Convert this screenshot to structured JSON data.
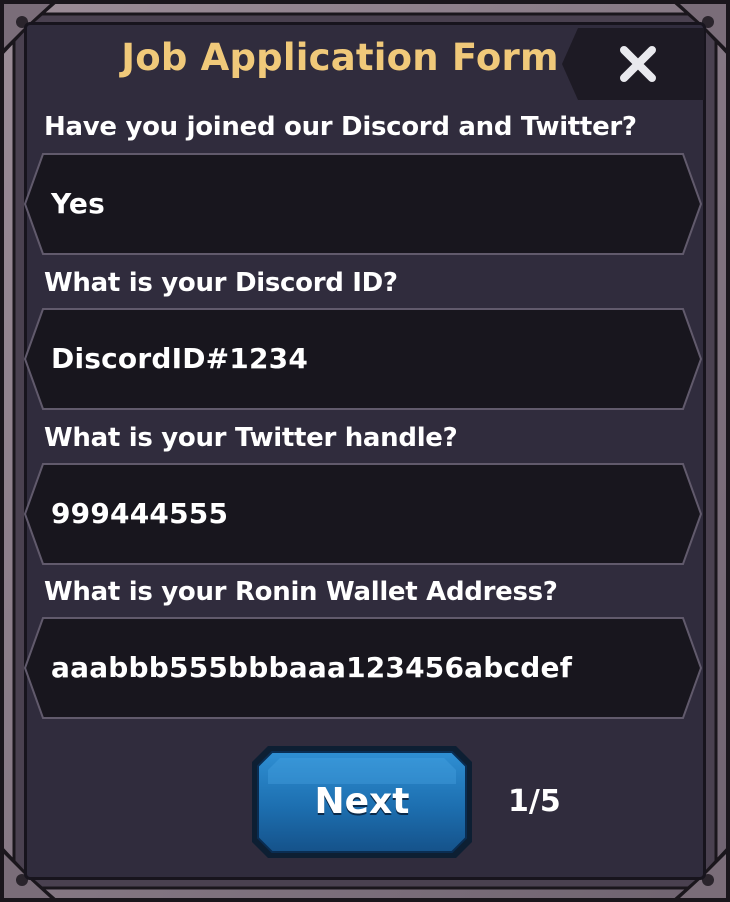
{
  "title": "Job Application Form",
  "close_icon": "close-x-icon",
  "questions": [
    {
      "label": "Have you joined our Discord and Twitter?",
      "answer": "Yes"
    },
    {
      "label": "What is your Discord ID?",
      "answer": "DiscordID#1234"
    },
    {
      "label": "What is your Twitter handle?",
      "answer": "999444555"
    },
    {
      "label": "What is your Ronin Wallet Address?",
      "answer": "aaabbb555bbbaaa123456abcdef"
    }
  ],
  "next_label": "Next",
  "page_indicator": "1/5",
  "colors": {
    "title": "#f0c97a",
    "panel": "#302c3d",
    "field": "#18161e",
    "frame": "#8a7b86",
    "button": "#1d6fb0"
  }
}
